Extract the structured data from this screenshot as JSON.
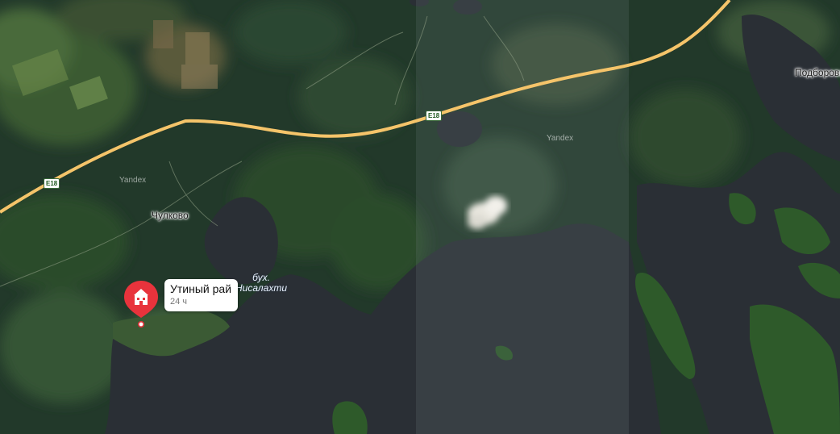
{
  "map": {
    "roads": [
      {
        "shield": "E18"
      },
      {
        "shield": "E18"
      }
    ],
    "places": [
      {
        "name": "Чулково"
      },
      {
        "name": "Подборовье"
      }
    ],
    "bay": {
      "line1": "бух.",
      "line2": "Нисалахти"
    },
    "watermarks": [
      "Yandex",
      "Yandex"
    ]
  },
  "poi": {
    "title": "Утиный рай",
    "hours": "24 ч",
    "icon": "hotel-icon",
    "color": "#e8333c"
  }
}
